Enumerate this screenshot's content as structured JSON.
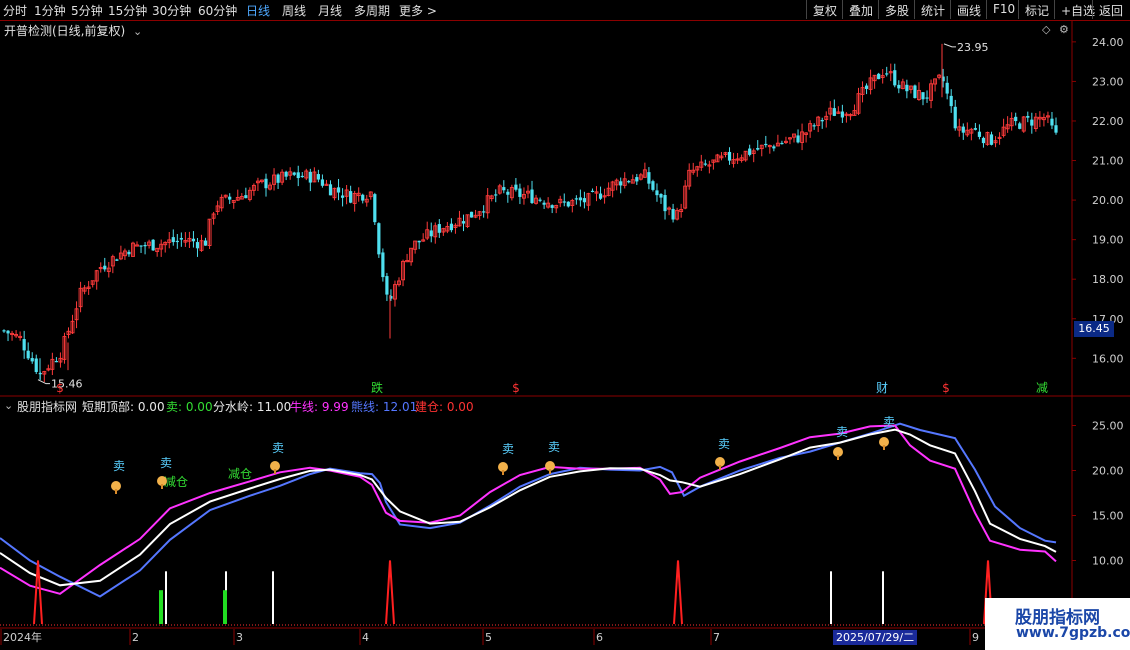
{
  "toolbar": {
    "periods": [
      "分时",
      "1分钟",
      "5分钟",
      "15分钟",
      "30分钟",
      "60分钟",
      "日线",
      "周线",
      "月线",
      "多周期",
      "更多 >"
    ],
    "active_period": "日线",
    "tools": [
      "复权",
      "叠加",
      "多股",
      "统计",
      "画线",
      "F10",
      "标记",
      "+自选",
      "返回"
    ]
  },
  "main_chart": {
    "title": "开普检测(日线,前复权)",
    "y_ticks": [
      "24.00",
      "23.00",
      "22.00",
      "21.00",
      "20.00",
      "19.00",
      "18.00",
      "17.00",
      "16.00"
    ],
    "high_label": "23.95",
    "low_label": "15.46",
    "current_price": "16.45",
    "signals": [
      {
        "text": "跌",
        "color": "#33dd33"
      },
      {
        "text": "$",
        "color": "#ff3333"
      },
      {
        "text": "$",
        "color": "#ff3333"
      },
      {
        "text": "财",
        "color": "#5ad0ff"
      },
      {
        "text": "$",
        "color": "#ff3333"
      },
      {
        "text": "减",
        "color": "#33dd33"
      }
    ]
  },
  "indicator": {
    "name": "股朋指标网",
    "fields": [
      {
        "label": "短期顶部: ",
        "value": "0.00",
        "color": "#e8e8e8"
      },
      {
        "label": "卖: ",
        "value": "0.00",
        "color": "#33dd33"
      },
      {
        "label": "分水岭: ",
        "value": "11.00",
        "color": "#e8e8e8"
      },
      {
        "label": "牛线: ",
        "value": "9.99",
        "color": "#ff33ff"
      },
      {
        "label": "熊线: ",
        "value": "12.01",
        "color": "#5577ff"
      },
      {
        "label": "建仓: ",
        "value": "0.00",
        "color": "#ff3333"
      }
    ],
    "y_ticks": [
      "25.00",
      "20.00",
      "15.00",
      "10.00",
      "5.00"
    ],
    "marks": [
      {
        "text": "卖",
        "color": "#5ad0ff"
      },
      {
        "text": "卖",
        "color": "#5ad0ff"
      },
      {
        "text": "减仓",
        "color": "#33dd33"
      },
      {
        "text": "减仓",
        "color": "#33dd33"
      },
      {
        "text": "卖",
        "color": "#5ad0ff"
      },
      {
        "text": "卖",
        "color": "#5ad0ff"
      },
      {
        "text": "卖",
        "color": "#5ad0ff"
      },
      {
        "text": "卖",
        "color": "#5ad0ff"
      },
      {
        "text": "卖",
        "color": "#5ad0ff"
      },
      {
        "text": "卖",
        "color": "#5ad0ff"
      }
    ]
  },
  "x_axis": {
    "labels": [
      "2024年",
      "2",
      "3",
      "4",
      "5",
      "6",
      "7",
      "9"
    ],
    "cursor_date": "2025/07/29/二"
  },
  "watermark": {
    "line1": "股朋指标网",
    "line2": "www.7gpzb.com"
  },
  "colors": {
    "up": "#ff3b3b",
    "down": "#4fe0f0",
    "bull": "#ff33ff",
    "bear": "#5577ff",
    "mid": "#ffffff",
    "axis": "#8b0000"
  },
  "chart_data": {
    "type": "line",
    "series": [],
    "ylim_main": [
      15.3,
      24.3
    ],
    "ylim_indicator": [
      2.5,
      26.5
    ]
  }
}
